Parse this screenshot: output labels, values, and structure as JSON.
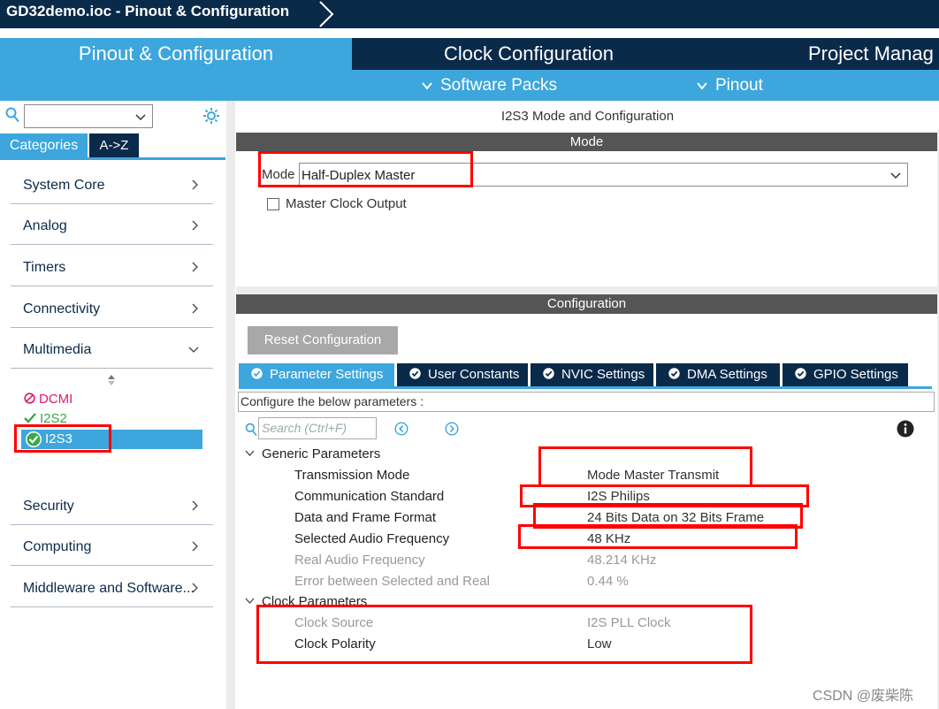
{
  "window": {
    "title": "GD32demo.ioc - Pinout & Configuration"
  },
  "main_tabs": [
    {
      "label": "Pinout & Configuration",
      "active": true
    },
    {
      "label": "Clock Configuration",
      "active": false
    },
    {
      "label": "Project Manag",
      "active": false
    }
  ],
  "sub_tabs": [
    {
      "label": "Software Packs",
      "icon": "chevron-down-icon"
    },
    {
      "label": "Pinout",
      "icon": "chevron-down-icon"
    }
  ],
  "sidebar": {
    "search_value": "",
    "tabs": [
      {
        "label": "Categories",
        "active": true
      },
      {
        "label": "A->Z",
        "active": false
      }
    ],
    "categories": [
      {
        "label": "System Core",
        "expanded": false
      },
      {
        "label": "Analog",
        "expanded": false
      },
      {
        "label": "Timers",
        "expanded": false
      },
      {
        "label": "Connectivity",
        "expanded": false
      },
      {
        "label": "Multimedia",
        "expanded": true
      },
      {
        "label": "Security",
        "expanded": false
      },
      {
        "label": "Computing",
        "expanded": false
      },
      {
        "label": "Middleware and Software...",
        "expanded": false
      }
    ],
    "multimedia_items": [
      {
        "label": "DCMI",
        "status": "disabled",
        "color": "#e0196e"
      },
      {
        "label": "I2S2",
        "status": "ok",
        "color": "#3aa84a"
      },
      {
        "label": "I2S3",
        "status": "selected",
        "color": "#ffffff"
      }
    ]
  },
  "panel": {
    "heading": "I2S3 Mode and Configuration",
    "mode_section": "Mode",
    "mode_label": "Mode",
    "mode_value": "Half-Duplex Master",
    "master_clock_output": {
      "label": "Master Clock Output",
      "checked": false
    },
    "config_section": "Configuration",
    "reset_button": "Reset Configuration",
    "config_tabs": [
      {
        "label": "Parameter Settings",
        "active": true
      },
      {
        "label": "User Constants",
        "active": false
      },
      {
        "label": "NVIC Settings",
        "active": false
      },
      {
        "label": "DMA Settings",
        "active": false
      },
      {
        "label": "GPIO Settings",
        "active": false
      }
    ],
    "hint": "Configure the below parameters :",
    "search_placeholder": "Search (Ctrl+F)",
    "groups": [
      {
        "name": "Generic Parameters",
        "params": [
          {
            "name": "Transmission Mode",
            "value": "Mode Master Transmit",
            "editable": true
          },
          {
            "name": "Communication Standard",
            "value": "I2S Philips",
            "editable": true
          },
          {
            "name": "Data and Frame Format",
            "value": "24 Bits Data on 32 Bits Frame",
            "editable": true
          },
          {
            "name": "Selected Audio Frequency",
            "value": "48 KHz",
            "editable": true
          },
          {
            "name": "Real Audio Frequency",
            "value": "48.214 KHz",
            "editable": false
          },
          {
            "name": "Error between Selected and Real",
            "value": "0.44 %",
            "editable": false
          }
        ]
      },
      {
        "name": "Clock Parameters",
        "params": [
          {
            "name": "Clock Source",
            "value": "I2S PLL Clock",
            "editable": false
          },
          {
            "name": "Clock Polarity",
            "value": "Low",
            "editable": true
          }
        ]
      }
    ]
  },
  "colors": {
    "navy": "#0a2a4a",
    "accent": "#3da6dc",
    "section_bar": "#555555",
    "annotation": "#ff0000"
  },
  "watermark": "CSDN @废柴陈"
}
